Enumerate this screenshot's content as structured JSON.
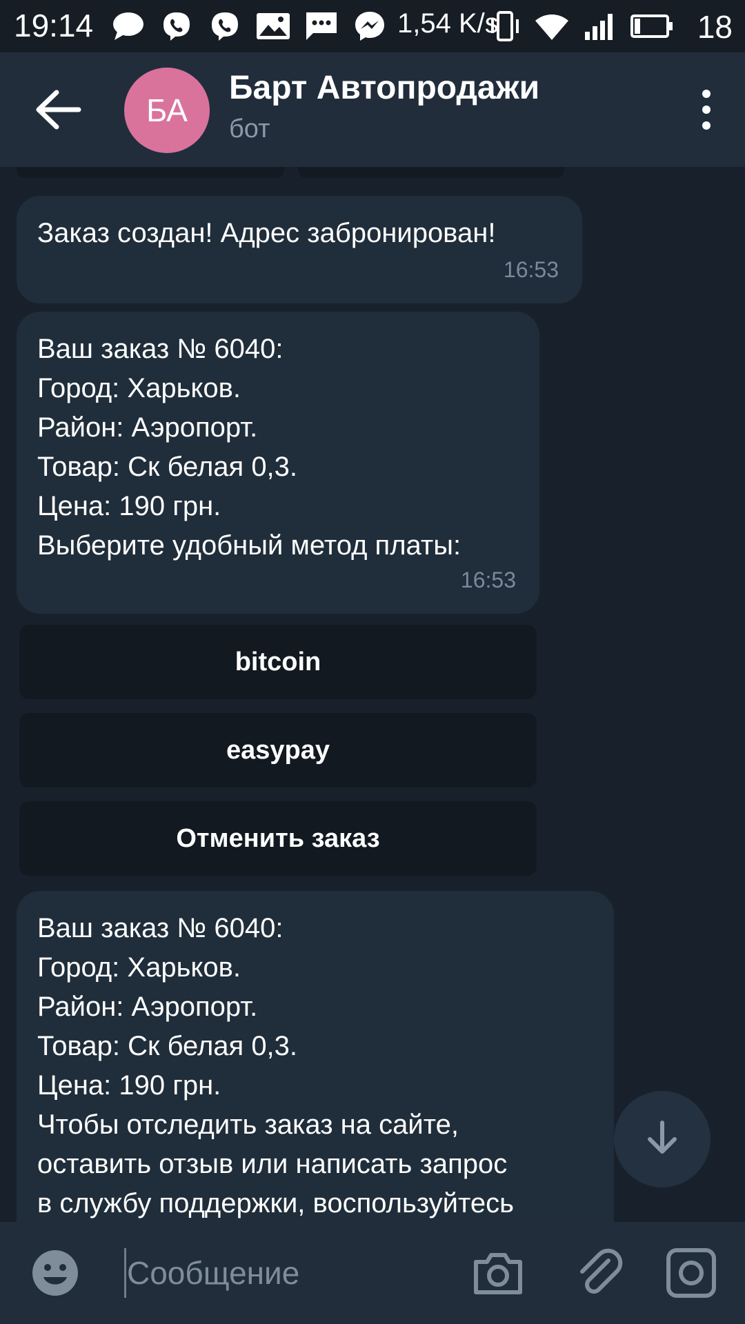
{
  "status_bar": {
    "time": "19:14",
    "speed": "1,54 K/s",
    "battery": "18"
  },
  "header": {
    "avatar_initials": "БА",
    "title": "Барт Автопродажи",
    "subtitle": "бот"
  },
  "messages": [
    {
      "text": "Заказ создан! Адрес забронирован!",
      "time": "16:53"
    },
    {
      "text": "Ваш заказ № 6040:\nГород: Харьков.\nРайон: Аэропорт.\nТовар: Ск белая 0,3.\nЦена: 190 грн.\nВыберите удобный метод платы:",
      "time": "16:53"
    },
    {
      "text": "Ваш заказ № 6040:\nГород: Харьков.\nРайон: Аэропорт.\nТовар: Ск белая 0,3.\nЦена: 190 грн.\nЧтобы отследить заказ на сайте,\nоставить отзыв или написать запрос\nв службу поддержки, воспользуйтесь"
    }
  ],
  "keyboard_buttons": [
    "bitcoin",
    "easypay",
    "Отменить заказ"
  ],
  "input": {
    "placeholder": "Сообщение"
  },
  "colors": {
    "background": "#18212b",
    "header": "#212d3b",
    "bubble": "#202d3a",
    "avatar": "#d9739c"
  }
}
